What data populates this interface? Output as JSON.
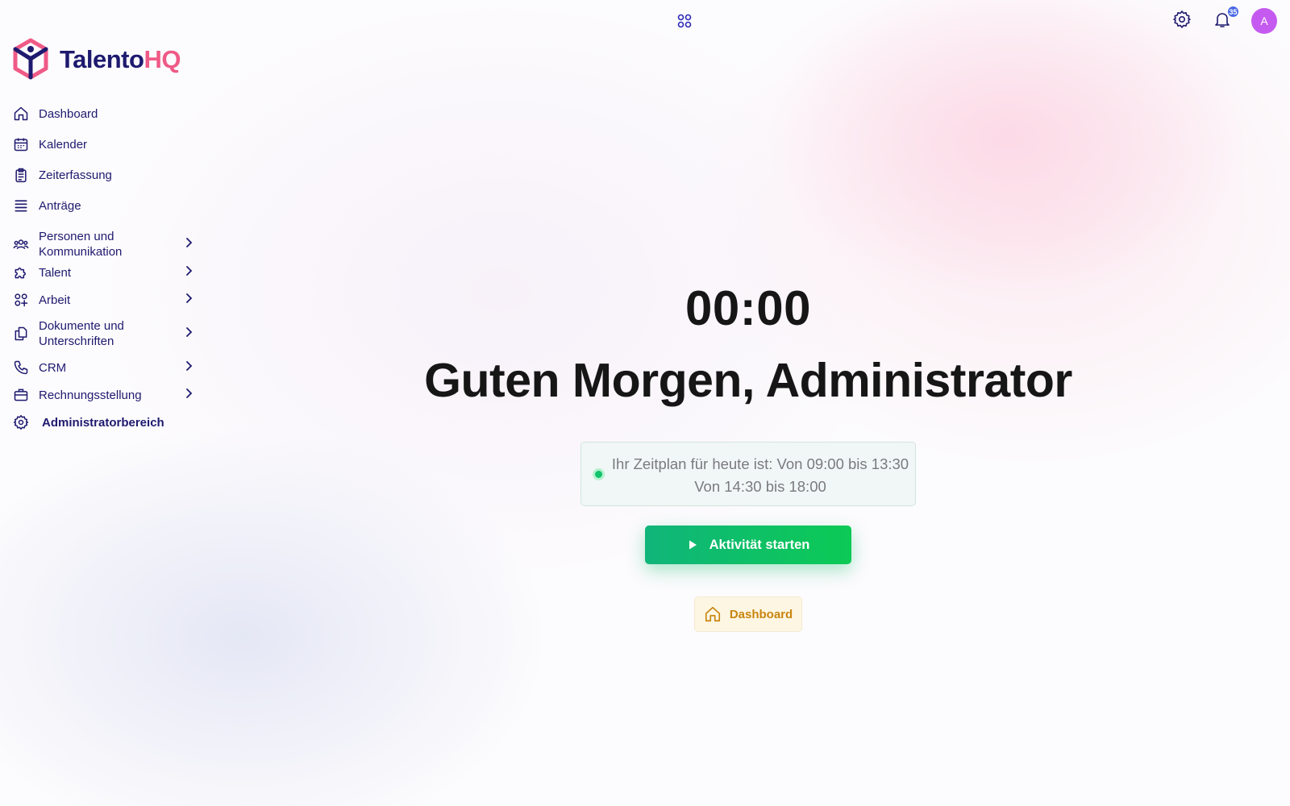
{
  "brand": {
    "name_part1": "Talento",
    "name_part2": "HQ"
  },
  "sidebar": {
    "items": [
      {
        "label": "Dashboard",
        "icon": "home-icon"
      },
      {
        "label": "Kalender",
        "icon": "calendar-icon"
      },
      {
        "label": "Zeiterfassung",
        "icon": "clipboard-icon"
      },
      {
        "label": "Anträge",
        "icon": "list-icon"
      },
      {
        "label": "Personen und Kommunikation",
        "icon": "users-icon",
        "has_submenu": true
      },
      {
        "label": "Talent",
        "icon": "puzzle-icon",
        "has_submenu": true
      },
      {
        "label": "Arbeit",
        "icon": "apps-plus-icon",
        "has_submenu": true
      },
      {
        "label": "Dokumente und Unterschriften",
        "icon": "documents-icon",
        "has_submenu": true
      },
      {
        "label": "CRM",
        "icon": "phone-icon",
        "has_submenu": true
      },
      {
        "label": "Rechnungsstellung",
        "icon": "briefcase-icon",
        "has_submenu": true
      },
      {
        "label": "Administratorbereich",
        "icon": "gear-icon"
      }
    ]
  },
  "topbar": {
    "notification_count": "35",
    "avatar_initial": "A"
  },
  "main": {
    "timer": "00:00",
    "greeting": "Guten Morgen, Administrator",
    "schedule_line1": "Ihr Zeitplan für heute ist: Von 09:00 bis 13:30",
    "schedule_line2": "Von 14:30 bis 18:00",
    "start_button": "Aktivität starten",
    "dashboard_button": "Dashboard"
  },
  "colors": {
    "brand_navy": "#1e1a6f",
    "brand_pink": "#ef5a86",
    "start_green": "#10c46b",
    "dashboard_amber": "#c9850f",
    "avatar_purple": "#c55af0"
  }
}
